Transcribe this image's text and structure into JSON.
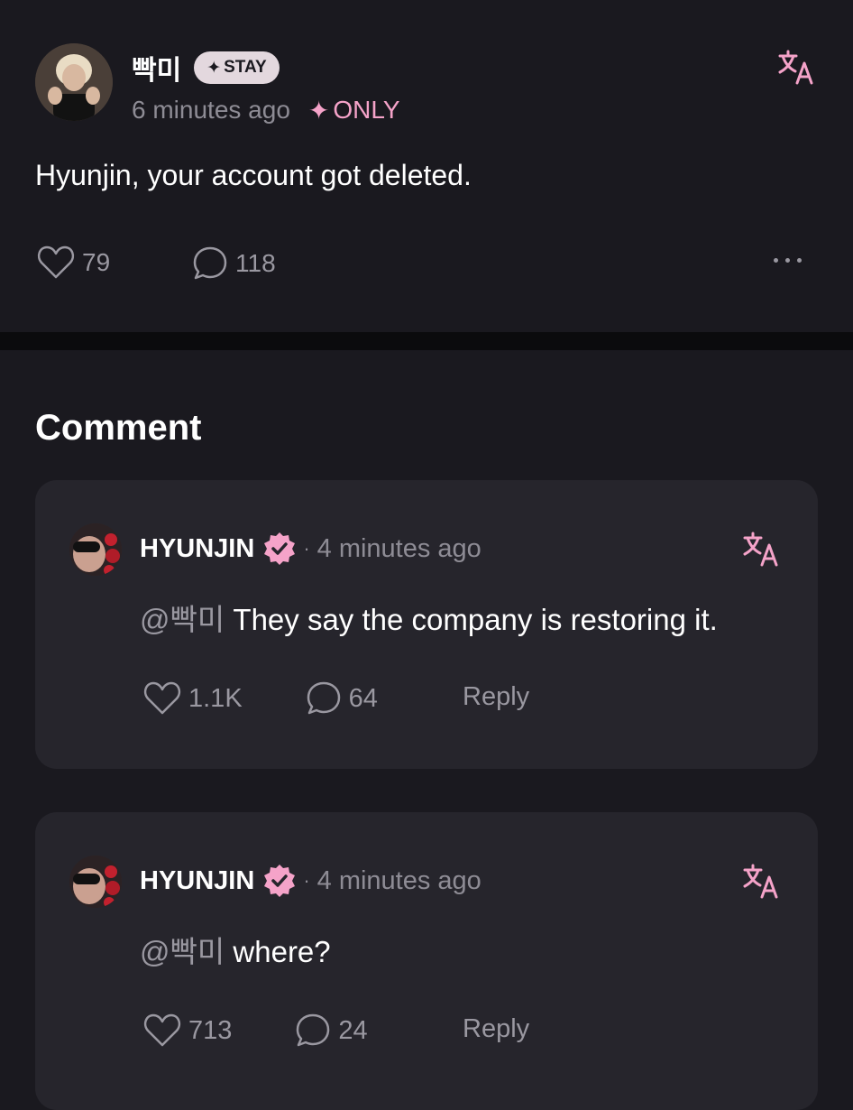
{
  "post": {
    "author": "빡미",
    "badge": "STAY",
    "time": "6 minutes ago",
    "only_label": "ONLY",
    "body": "Hyunjin, your account got deleted.",
    "likes": "79",
    "comments": "118"
  },
  "section": {
    "title": "Comment"
  },
  "comments": [
    {
      "author": "HYUNJIN",
      "separator": "·",
      "time": "4 minutes ago",
      "mention": "@빡미",
      "text": "They say the company is restoring it.",
      "likes": "1.1K",
      "replies": "64",
      "reply_label": "Reply"
    },
    {
      "author": "HYUNJIN",
      "separator": "·",
      "time": "4 minutes ago",
      "mention": "@빡미",
      "text": "where?",
      "likes": "713",
      "replies": "24",
      "reply_label": "Reply"
    }
  ],
  "colors": {
    "background": "#1a191f",
    "card": "#26252c",
    "accent_pink": "#f5a3c9",
    "muted_text": "#8e8c95"
  },
  "icons": [
    "translate-icon",
    "heart-icon",
    "comment-bubble-icon",
    "more-icon",
    "verified-icon",
    "sparkle-icon"
  ]
}
